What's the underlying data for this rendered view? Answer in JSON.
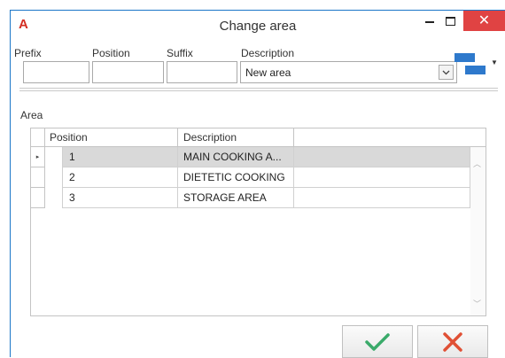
{
  "window": {
    "logo": "A",
    "title": "Change area",
    "min_glyph": "—",
    "close_glyph": "✕"
  },
  "fields": {
    "prefix_label": "Prefix",
    "position_label": "Position",
    "suffix_label": "Suffix",
    "description_label": "Description",
    "prefix_value": "",
    "position_value": "",
    "suffix_value": "",
    "description_value": "New area"
  },
  "icons": {
    "logo": "app-logo",
    "minimize": "minimize-icon",
    "maximize": "maximize-icon",
    "close": "close-icon",
    "dropdown": "chevron-down-icon",
    "layout": "layout-toggle-icon",
    "row_indicator": "current-row-arrow-icon",
    "confirm": "checkmark-icon",
    "cancel": "cross-icon"
  },
  "colors": {
    "accent_blue": "#2e79cc",
    "close_red": "#e04343",
    "logo_red": "#d42e22",
    "confirm_green": "#3aaa6a",
    "cancel_red": "#e05035",
    "selected_row": "#d9d9d9"
  },
  "grid": {
    "section_label": "Area",
    "columns": [
      "Position",
      "Description"
    ],
    "rows": [
      {
        "position": "1",
        "description": "MAIN COOKING A...",
        "selected": true
      },
      {
        "position": "2",
        "description": "DIETETIC COOKING",
        "selected": false
      },
      {
        "position": "3",
        "description": "STORAGE AREA",
        "selected": false
      }
    ],
    "current_row_marker": "▸"
  }
}
